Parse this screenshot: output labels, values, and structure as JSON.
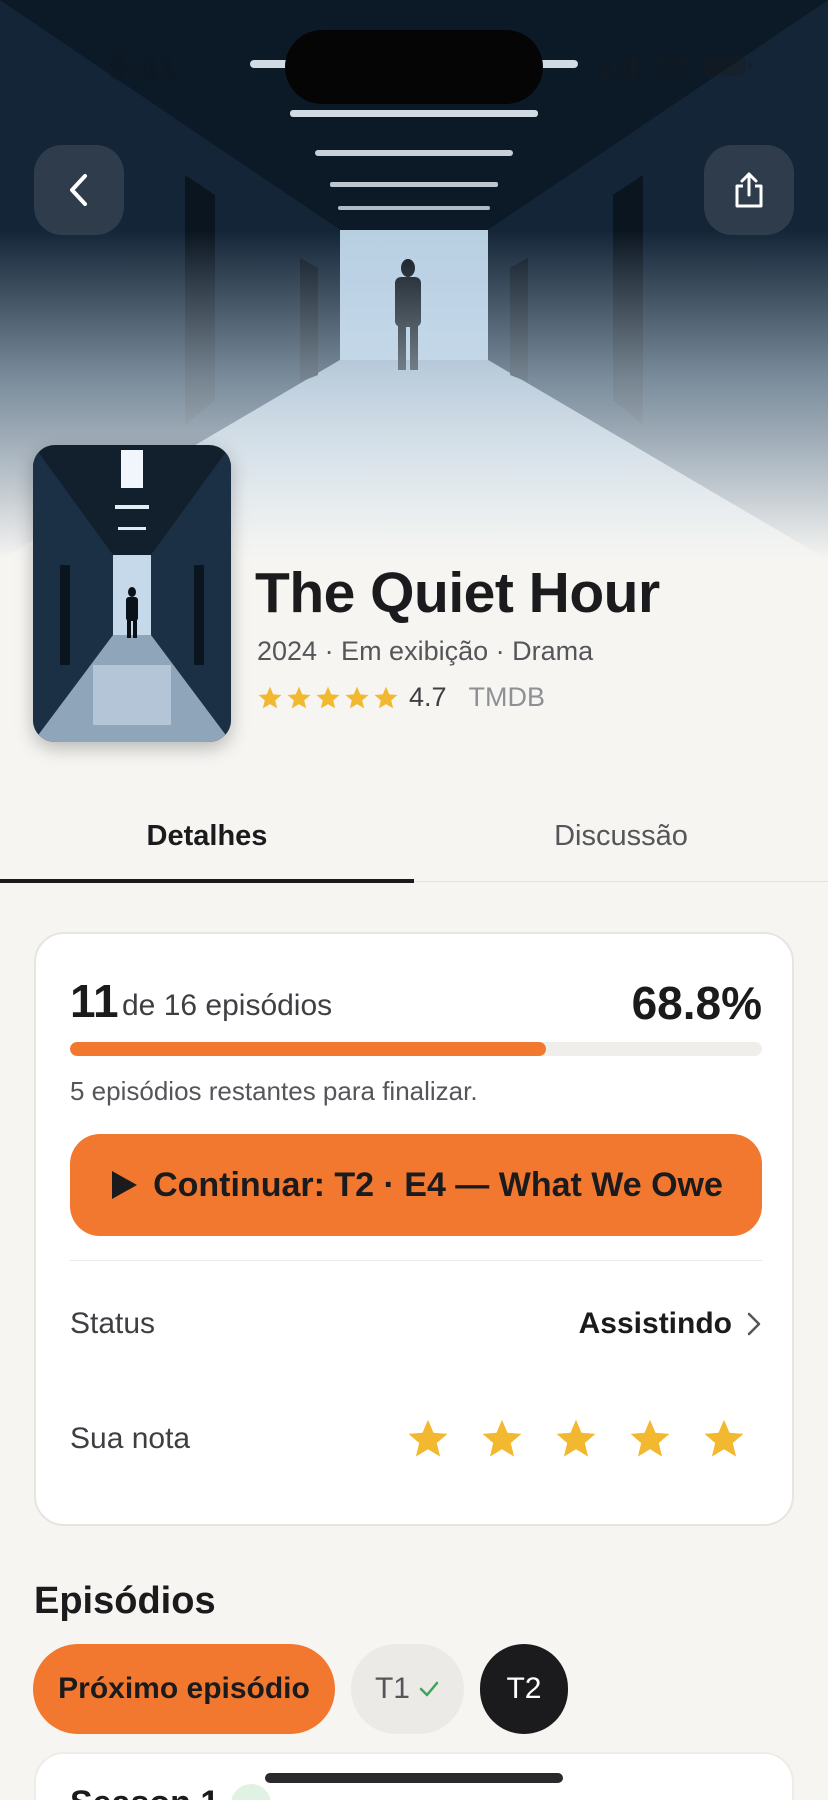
{
  "status_bar": {
    "time": "9:41"
  },
  "show": {
    "title": "The Quiet Hour",
    "meta": "2024 · Em exibição · Drama",
    "rating_stars": 5,
    "rating_value": "4.7",
    "rating_source": "TMDB"
  },
  "tabs": [
    {
      "label": "Detalhes",
      "active": true
    },
    {
      "label": "Discussão",
      "active": false
    }
  ],
  "progress": {
    "watched": "11",
    "of_label": "de 16 episódios",
    "percent_label": "68.8%",
    "fraction": 0.688,
    "remaining": "5 episódios restantes para finalizar.",
    "continue_label": "Continuar: T2 · E4 — What We Owe"
  },
  "status_row": {
    "label": "Status",
    "value": "Assistindo"
  },
  "user_rating": {
    "label": "Sua nota",
    "stars": 5
  },
  "episodes": {
    "title": "Episódios",
    "chips": [
      {
        "label": "Próximo episódio",
        "style": "accent"
      },
      {
        "label": "T1",
        "completed": true
      },
      {
        "label": "T2",
        "selected": true
      }
    ],
    "season_label": "Season 1"
  },
  "colors": {
    "accent": "#f2782f",
    "star": "#f2b82f",
    "text": "#1b1b1d",
    "background": "#f6f5f2"
  },
  "icons": [
    "chevron-left-icon",
    "share-icon",
    "star-icon",
    "play-icon",
    "chevron-right-icon",
    "check-icon"
  ]
}
